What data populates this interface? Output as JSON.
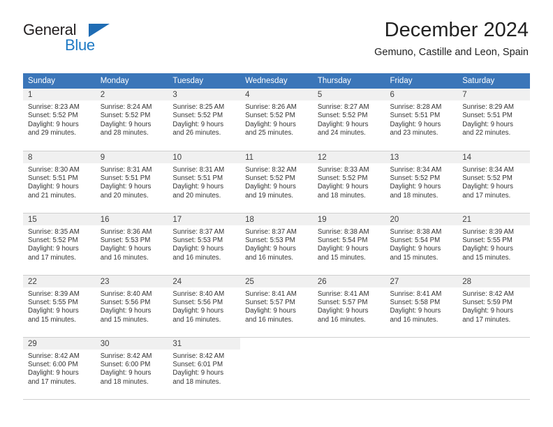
{
  "brand": {
    "name_top": "General",
    "name_bottom": "Blue",
    "accent_color": "#1f7ac4",
    "triangle_color": "#1f6cb4"
  },
  "header": {
    "title": "December 2024",
    "location": "Gemuno, Castille and Leon, Spain"
  },
  "calendar": {
    "header_bg": "#3b76b9",
    "daynum_bg": "#f0f0f0",
    "weekday_headers": [
      "Sunday",
      "Monday",
      "Tuesday",
      "Wednesday",
      "Thursday",
      "Friday",
      "Saturday"
    ],
    "weeks": [
      [
        {
          "day": "1",
          "sunrise": "Sunrise: 8:23 AM",
          "sunset": "Sunset: 5:52 PM",
          "daylight_line1": "Daylight: 9 hours",
          "daylight_line2": "and 29 minutes."
        },
        {
          "day": "2",
          "sunrise": "Sunrise: 8:24 AM",
          "sunset": "Sunset: 5:52 PM",
          "daylight_line1": "Daylight: 9 hours",
          "daylight_line2": "and 28 minutes."
        },
        {
          "day": "3",
          "sunrise": "Sunrise: 8:25 AM",
          "sunset": "Sunset: 5:52 PM",
          "daylight_line1": "Daylight: 9 hours",
          "daylight_line2": "and 26 minutes."
        },
        {
          "day": "4",
          "sunrise": "Sunrise: 8:26 AM",
          "sunset": "Sunset: 5:52 PM",
          "daylight_line1": "Daylight: 9 hours",
          "daylight_line2": "and 25 minutes."
        },
        {
          "day": "5",
          "sunrise": "Sunrise: 8:27 AM",
          "sunset": "Sunset: 5:52 PM",
          "daylight_line1": "Daylight: 9 hours",
          "daylight_line2": "and 24 minutes."
        },
        {
          "day": "6",
          "sunrise": "Sunrise: 8:28 AM",
          "sunset": "Sunset: 5:51 PM",
          "daylight_line1": "Daylight: 9 hours",
          "daylight_line2": "and 23 minutes."
        },
        {
          "day": "7",
          "sunrise": "Sunrise: 8:29 AM",
          "sunset": "Sunset: 5:51 PM",
          "daylight_line1": "Daylight: 9 hours",
          "daylight_line2": "and 22 minutes."
        }
      ],
      [
        {
          "day": "8",
          "sunrise": "Sunrise: 8:30 AM",
          "sunset": "Sunset: 5:51 PM",
          "daylight_line1": "Daylight: 9 hours",
          "daylight_line2": "and 21 minutes."
        },
        {
          "day": "9",
          "sunrise": "Sunrise: 8:31 AM",
          "sunset": "Sunset: 5:51 PM",
          "daylight_line1": "Daylight: 9 hours",
          "daylight_line2": "and 20 minutes."
        },
        {
          "day": "10",
          "sunrise": "Sunrise: 8:31 AM",
          "sunset": "Sunset: 5:51 PM",
          "daylight_line1": "Daylight: 9 hours",
          "daylight_line2": "and 20 minutes."
        },
        {
          "day": "11",
          "sunrise": "Sunrise: 8:32 AM",
          "sunset": "Sunset: 5:52 PM",
          "daylight_line1": "Daylight: 9 hours",
          "daylight_line2": "and 19 minutes."
        },
        {
          "day": "12",
          "sunrise": "Sunrise: 8:33 AM",
          "sunset": "Sunset: 5:52 PM",
          "daylight_line1": "Daylight: 9 hours",
          "daylight_line2": "and 18 minutes."
        },
        {
          "day": "13",
          "sunrise": "Sunrise: 8:34 AM",
          "sunset": "Sunset: 5:52 PM",
          "daylight_line1": "Daylight: 9 hours",
          "daylight_line2": "and 18 minutes."
        },
        {
          "day": "14",
          "sunrise": "Sunrise: 8:34 AM",
          "sunset": "Sunset: 5:52 PM",
          "daylight_line1": "Daylight: 9 hours",
          "daylight_line2": "and 17 minutes."
        }
      ],
      [
        {
          "day": "15",
          "sunrise": "Sunrise: 8:35 AM",
          "sunset": "Sunset: 5:52 PM",
          "daylight_line1": "Daylight: 9 hours",
          "daylight_line2": "and 17 minutes."
        },
        {
          "day": "16",
          "sunrise": "Sunrise: 8:36 AM",
          "sunset": "Sunset: 5:53 PM",
          "daylight_line1": "Daylight: 9 hours",
          "daylight_line2": "and 16 minutes."
        },
        {
          "day": "17",
          "sunrise": "Sunrise: 8:37 AM",
          "sunset": "Sunset: 5:53 PM",
          "daylight_line1": "Daylight: 9 hours",
          "daylight_line2": "and 16 minutes."
        },
        {
          "day": "18",
          "sunrise": "Sunrise: 8:37 AM",
          "sunset": "Sunset: 5:53 PM",
          "daylight_line1": "Daylight: 9 hours",
          "daylight_line2": "and 16 minutes."
        },
        {
          "day": "19",
          "sunrise": "Sunrise: 8:38 AM",
          "sunset": "Sunset: 5:54 PM",
          "daylight_line1": "Daylight: 9 hours",
          "daylight_line2": "and 15 minutes."
        },
        {
          "day": "20",
          "sunrise": "Sunrise: 8:38 AM",
          "sunset": "Sunset: 5:54 PM",
          "daylight_line1": "Daylight: 9 hours",
          "daylight_line2": "and 15 minutes."
        },
        {
          "day": "21",
          "sunrise": "Sunrise: 8:39 AM",
          "sunset": "Sunset: 5:55 PM",
          "daylight_line1": "Daylight: 9 hours",
          "daylight_line2": "and 15 minutes."
        }
      ],
      [
        {
          "day": "22",
          "sunrise": "Sunrise: 8:39 AM",
          "sunset": "Sunset: 5:55 PM",
          "daylight_line1": "Daylight: 9 hours",
          "daylight_line2": "and 15 minutes."
        },
        {
          "day": "23",
          "sunrise": "Sunrise: 8:40 AM",
          "sunset": "Sunset: 5:56 PM",
          "daylight_line1": "Daylight: 9 hours",
          "daylight_line2": "and 15 minutes."
        },
        {
          "day": "24",
          "sunrise": "Sunrise: 8:40 AM",
          "sunset": "Sunset: 5:56 PM",
          "daylight_line1": "Daylight: 9 hours",
          "daylight_line2": "and 16 minutes."
        },
        {
          "day": "25",
          "sunrise": "Sunrise: 8:41 AM",
          "sunset": "Sunset: 5:57 PM",
          "daylight_line1": "Daylight: 9 hours",
          "daylight_line2": "and 16 minutes."
        },
        {
          "day": "26",
          "sunrise": "Sunrise: 8:41 AM",
          "sunset": "Sunset: 5:57 PM",
          "daylight_line1": "Daylight: 9 hours",
          "daylight_line2": "and 16 minutes."
        },
        {
          "day": "27",
          "sunrise": "Sunrise: 8:41 AM",
          "sunset": "Sunset: 5:58 PM",
          "daylight_line1": "Daylight: 9 hours",
          "daylight_line2": "and 16 minutes."
        },
        {
          "day": "28",
          "sunrise": "Sunrise: 8:42 AM",
          "sunset": "Sunset: 5:59 PM",
          "daylight_line1": "Daylight: 9 hours",
          "daylight_line2": "and 17 minutes."
        }
      ],
      [
        {
          "day": "29",
          "sunrise": "Sunrise: 8:42 AM",
          "sunset": "Sunset: 6:00 PM",
          "daylight_line1": "Daylight: 9 hours",
          "daylight_line2": "and 17 minutes."
        },
        {
          "day": "30",
          "sunrise": "Sunrise: 8:42 AM",
          "sunset": "Sunset: 6:00 PM",
          "daylight_line1": "Daylight: 9 hours",
          "daylight_line2": "and 18 minutes."
        },
        {
          "day": "31",
          "sunrise": "Sunrise: 8:42 AM",
          "sunset": "Sunset: 6:01 PM",
          "daylight_line1": "Daylight: 9 hours",
          "daylight_line2": "and 18 minutes."
        },
        {
          "day": "",
          "sunrise": "",
          "sunset": "",
          "daylight_line1": "",
          "daylight_line2": ""
        },
        {
          "day": "",
          "sunrise": "",
          "sunset": "",
          "daylight_line1": "",
          "daylight_line2": ""
        },
        {
          "day": "",
          "sunrise": "",
          "sunset": "",
          "daylight_line1": "",
          "daylight_line2": ""
        },
        {
          "day": "",
          "sunrise": "",
          "sunset": "",
          "daylight_line1": "",
          "daylight_line2": ""
        }
      ]
    ]
  }
}
